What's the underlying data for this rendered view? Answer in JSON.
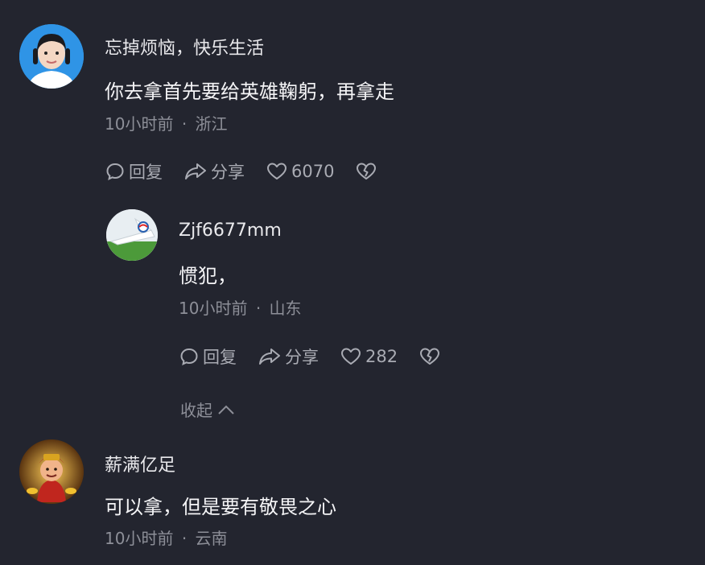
{
  "comments": [
    {
      "username": "忘掉烦恼，快乐生活",
      "content": "你去拿首先要给英雄鞠躬，再拿走",
      "time": "10小时前",
      "separator": "·",
      "location": "浙江",
      "reply_label": "回复",
      "share_label": "分享",
      "like_count": "6070",
      "avatar_icon": "child-portrait-avatar"
    },
    {
      "username": "Zjf6677mm",
      "content": "惯犯，",
      "time": "10小时前",
      "separator": "·",
      "location": "山东",
      "reply_label": "回复",
      "share_label": "分享",
      "like_count": "282",
      "avatar_icon": "airplane-tail-avatar"
    },
    {
      "username": "薪满亿足",
      "content": "可以拿，但是要有敬畏之心",
      "time": "10小时前",
      "separator": "·",
      "location": "云南",
      "avatar_icon": "fortune-god-avatar"
    }
  ],
  "collapse_label": "收起",
  "colors": {
    "background": "#23252f",
    "text": "#f4f4f6",
    "meta": "#8d8f98",
    "action": "#a9abb3"
  }
}
